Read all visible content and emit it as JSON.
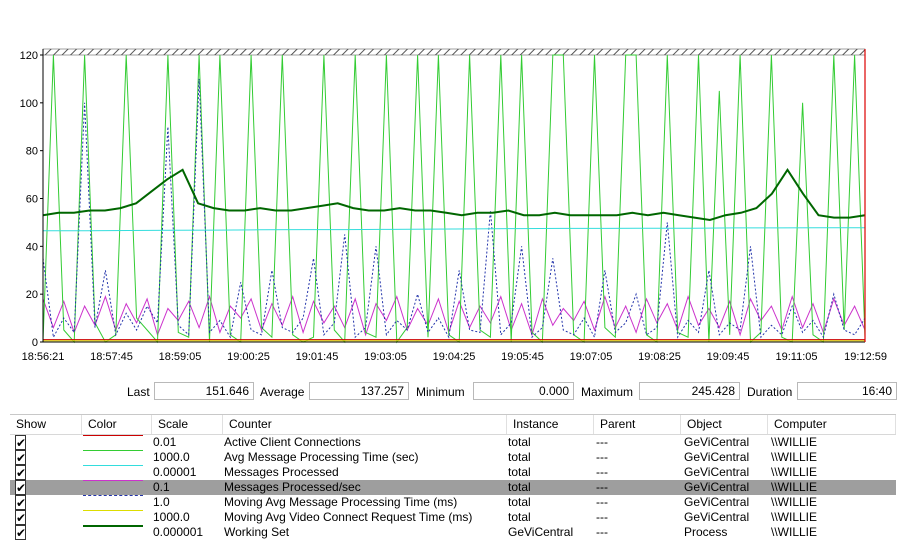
{
  "chart_data": {
    "type": "line",
    "x_tick_labels": [
      "18:56:21",
      "18:57:45",
      "18:59:05",
      "19:00:25",
      "19:01:45",
      "19:03:05",
      "19:04:25",
      "19:05:45",
      "19:07:05",
      "19:08:25",
      "19:09:45",
      "19:11:05",
      "19:12:59"
    ],
    "y_tick_labels": [
      "120",
      "100",
      "80",
      "60",
      "40",
      "20",
      "0"
    ],
    "ylim": [
      0,
      120
    ],
    "grid": false,
    "series": [
      {
        "name": "Active Client Connections",
        "color": "#cc0000",
        "style": "solid",
        "values": [
          1,
          1,
          1,
          1,
          1,
          1,
          1,
          1,
          1,
          1,
          1,
          1,
          1,
          1,
          1,
          1,
          1,
          1,
          1,
          1
        ]
      },
      {
        "name": "Avg Message Processing Time (sec)",
        "color": "#33cc33",
        "style": "solid",
        "values": [
          0,
          120,
          5,
          0,
          120,
          8,
          0,
          3,
          120,
          10,
          5,
          0,
          120,
          4,
          2,
          120,
          0,
          120,
          3,
          0,
          120,
          6,
          2,
          120,
          3,
          0,
          2,
          120,
          5,
          0,
          120,
          4,
          2,
          120,
          0,
          6,
          120,
          2,
          120,
          3,
          0,
          120,
          5,
          2,
          120,
          0,
          120,
          4,
          0,
          120,
          120,
          3,
          0,
          120,
          6,
          2,
          120,
          120,
          3,
          0,
          120,
          4,
          2,
          120,
          0,
          105,
          3,
          120,
          0,
          4,
          120,
          2,
          0,
          100,
          3,
          0,
          120,
          5,
          120,
          2
        ]
      },
      {
        "name": "Messages Processed",
        "color": "#33dddd",
        "style": "solid",
        "values": [
          46.5,
          46.5,
          46.6,
          46.7,
          46.8,
          46.9,
          47.0,
          47.0,
          47.1,
          47.2,
          47.3,
          47.4,
          47.5,
          47.5,
          47.6,
          47.6,
          47.7,
          47.7,
          47.8,
          47.8
        ]
      },
      {
        "name": "Messages Processed/sec",
        "color": "#cc33cc",
        "style": "solid",
        "values": [
          18,
          6,
          17,
          4,
          15,
          7,
          19,
          5,
          16,
          8,
          18,
          3,
          14,
          9,
          17,
          6,
          19,
          4,
          15,
          10,
          18,
          5,
          16,
          7,
          19,
          4,
          17,
          8,
          15,
          6,
          18,
          3,
          16,
          9,
          19,
          5,
          14,
          7,
          18,
          4,
          17,
          6,
          15,
          8,
          19,
          5,
          16,
          3,
          18,
          7,
          14,
          9,
          17,
          5,
          19,
          6,
          15,
          4,
          18,
          8,
          16,
          5,
          19,
          7,
          14,
          6,
          17,
          3,
          18,
          9,
          15,
          5,
          19,
          6,
          16,
          4,
          18,
          7,
          15,
          5
        ]
      },
      {
        "name": "Moving Avg Message Processing Time (ms)",
        "color": "#2233aa",
        "style": "dashed",
        "values": [
          35,
          2,
          10,
          4,
          100,
          6,
          30,
          3,
          12,
          5,
          15,
          8,
          90,
          7,
          3,
          110,
          4,
          9,
          2,
          25,
          5,
          3,
          30,
          6,
          4,
          10,
          35,
          3,
          8,
          45,
          2,
          6,
          40,
          3,
          9,
          5,
          20,
          4,
          10,
          2,
          30,
          5,
          4,
          55,
          3,
          8,
          40,
          2,
          6,
          35,
          5,
          3,
          10,
          2,
          30,
          4,
          8,
          20,
          3,
          6,
          50,
          2,
          9,
          4,
          30,
          3,
          8,
          5,
          40,
          2,
          7,
          3,
          15,
          4,
          9,
          2,
          20,
          5,
          3,
          10
        ]
      },
      {
        "name": "Moving Avg Video Connect Request Time (ms)",
        "color": "#dddd00",
        "style": "solid",
        "values": [
          0.5,
          0.5,
          0.5,
          0.5,
          0.5,
          0.5,
          0.5,
          0.5,
          0.5,
          0.5,
          0.5,
          0.5,
          0.5,
          0.5,
          0.5,
          0.5,
          0.5,
          0.5,
          0.5,
          0.5
        ]
      },
      {
        "name": "Working Set",
        "color": "#006600",
        "style": "thick",
        "values": [
          53,
          54,
          54,
          55,
          55,
          56,
          58,
          63,
          68,
          72,
          58,
          56,
          55,
          55,
          56,
          55,
          55,
          56,
          57,
          58,
          56,
          55,
          55,
          56,
          55,
          55,
          54,
          53,
          54,
          54,
          55,
          53,
          53,
          54,
          53,
          53,
          53,
          53,
          54,
          53,
          54,
          53,
          52,
          51,
          53,
          54,
          56,
          62,
          72,
          62,
          53,
          52,
          52,
          53
        ]
      }
    ]
  },
  "stats": {
    "last_label": "Last",
    "last_value": "151.646",
    "average_label": "Average",
    "average_value": "137.257",
    "minimum_label": "Minimum",
    "minimum_value": "0.000",
    "maximum_label": "Maximum",
    "maximum_value": "245.428",
    "duration_label": "Duration",
    "duration_value": "16:40"
  },
  "legend": {
    "headers": {
      "show": "Show",
      "color": "Color",
      "scale": "Scale",
      "counter": "Counter",
      "instance": "Instance",
      "parent": "Parent",
      "object": "Object",
      "computer": "Computer"
    },
    "check_glyph": "✔",
    "rows": [
      {
        "scale": "0.01",
        "counter": "Active Client Connections",
        "instance": "total",
        "parent": "---",
        "object": "GeViCentral",
        "computer": "\\\\WILLIE",
        "color": "#cc0000",
        "line": "solid",
        "selected": false
      },
      {
        "scale": "1000.0",
        "counter": "Avg Message Processing Time (sec)",
        "instance": "total",
        "parent": "---",
        "object": "GeViCentral",
        "computer": "\\\\WILLIE",
        "color": "#33cc33",
        "line": "solid",
        "selected": false
      },
      {
        "scale": "0.00001",
        "counter": "Messages Processed",
        "instance": "total",
        "parent": "---",
        "object": "GeViCentral",
        "computer": "\\\\WILLIE",
        "color": "#33dddd",
        "line": "solid",
        "selected": false
      },
      {
        "scale": "0.1",
        "counter": "Messages Processed/sec",
        "instance": "total",
        "parent": "---",
        "object": "GeViCentral",
        "computer": "\\\\WILLIE",
        "color": "#cc33cc",
        "line": "solid",
        "selected": true
      },
      {
        "scale": "1.0",
        "counter": "Moving Avg Message Processing Time (ms)",
        "instance": "total",
        "parent": "---",
        "object": "GeViCentral",
        "computer": "\\\\WILLIE",
        "color": "#2233aa",
        "line": "dashed",
        "selected": false
      },
      {
        "scale": "1000.0",
        "counter": "Moving Avg Video Connect Request Time (ms)",
        "instance": "total",
        "parent": "---",
        "object": "GeViCentral",
        "computer": "\\\\WILLIE",
        "color": "#dddd00",
        "line": "solid",
        "selected": false
      },
      {
        "scale": "0.000001",
        "counter": "Working Set",
        "instance": "GeViCentral",
        "parent": "---",
        "object": "Process",
        "computer": "\\\\WILLIE",
        "color": "#006600",
        "line": "thick",
        "selected": false
      }
    ]
  }
}
